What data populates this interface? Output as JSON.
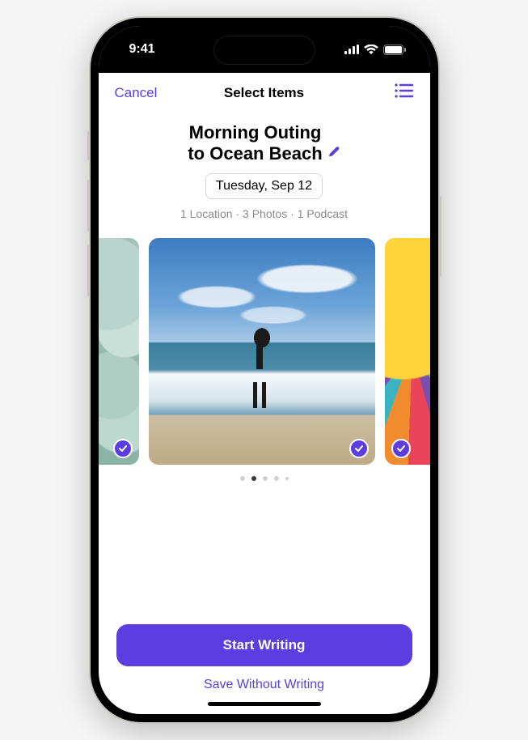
{
  "status_bar": {
    "time": "9:41"
  },
  "nav": {
    "cancel_label": "Cancel",
    "title": "Select Items"
  },
  "entry": {
    "title_line1": "Morning Outing",
    "title_line2": "to Ocean Beach",
    "date": "Tuesday, Sep 12",
    "summary": "1 Location · 3 Photos · 1 Podcast"
  },
  "carousel": {
    "active_index": 1,
    "dot_count": 5
  },
  "actions": {
    "primary": "Start Writing",
    "secondary": "Save Without Writing"
  },
  "colors": {
    "accent": "#5b3de0"
  }
}
